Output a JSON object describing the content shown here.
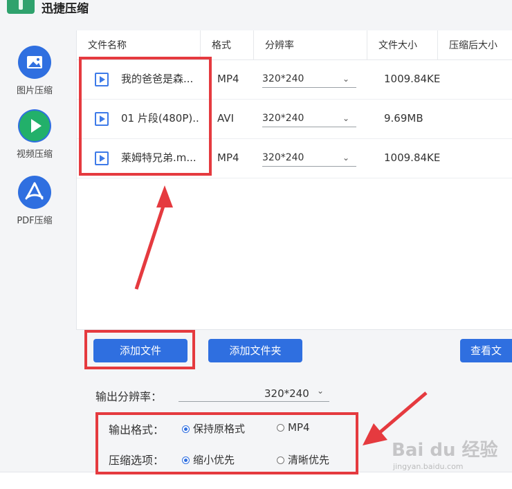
{
  "app": {
    "title": "迅捷压缩"
  },
  "sidebar": {
    "items": [
      {
        "label": "图片压缩",
        "icon": "image-icon"
      },
      {
        "label": "视频压缩",
        "icon": "play-icon"
      },
      {
        "label": "PDF压缩",
        "icon": "pdf-icon"
      }
    ]
  },
  "table": {
    "headers": [
      "文件名称",
      "格式",
      "分辨率",
      "文件大小",
      "压缩后大小"
    ],
    "rows": [
      {
        "name": "我的爸爸是森...",
        "format": "MP4",
        "resolution": "320*240",
        "size": "1009.84KE"
      },
      {
        "name": "01 片段(480P)..",
        "format": "AVI",
        "resolution": "320*240",
        "size": "9.69MB"
      },
      {
        "name": "莱姆特兄弟.m...",
        "format": "MP4",
        "resolution": "320*240",
        "size": "1009.84KE"
      }
    ]
  },
  "buttons": {
    "add_file": "添加文件",
    "add_folder": "添加文件夹",
    "view": "查看文"
  },
  "output": {
    "resolution_label": "输出分辨率：",
    "resolution_value": "320*240",
    "format_label": "输出格式：",
    "format_options": [
      "保持原格式",
      "MP4"
    ],
    "format_selected": "保持原格式",
    "compress_label": "压缩选项：",
    "compress_options": [
      "缩小优先",
      "清晰优先"
    ],
    "compress_selected": "缩小优先"
  },
  "watermark": {
    "main": "Bai du 经验",
    "sub": "jingyan.baidu.com"
  },
  "colors": {
    "accent": "#2f6fe0",
    "annotation": "#e53a3f"
  }
}
